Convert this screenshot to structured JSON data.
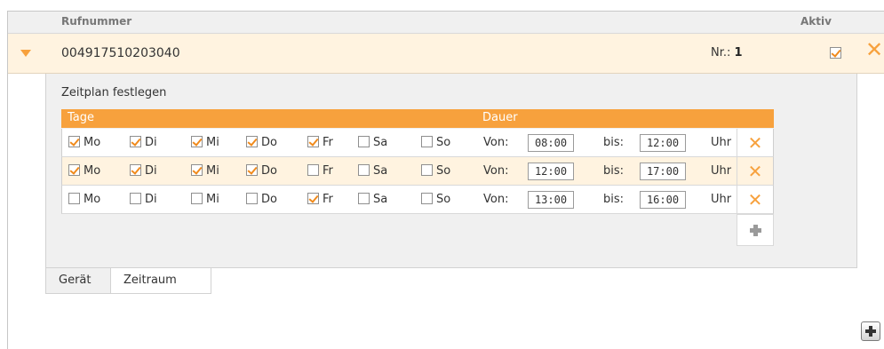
{
  "header": {
    "rufnummer_label": "Rufnummer",
    "aktiv_label": "Aktiv"
  },
  "entry": {
    "number": "004917510203040",
    "nr_label": "Nr.:",
    "nr_value": "1",
    "aktiv": true,
    "expand_icon": "triangle-down-icon",
    "delete_icon": "close-icon"
  },
  "schedule": {
    "title": "Zeitplan festlegen",
    "col_days": "Tage",
    "col_duration": "Dauer",
    "from_label": "Von:",
    "to_label": "bis:",
    "unit_label": "Uhr",
    "rows": [
      {
        "days": [
          {
            "label": "Mo",
            "checked": true
          },
          {
            "label": "Di",
            "checked": true
          },
          {
            "label": "Mi",
            "checked": true
          },
          {
            "label": "Do",
            "checked": true
          },
          {
            "label": "Fr",
            "checked": true
          },
          {
            "label": "Sa",
            "checked": false
          },
          {
            "label": "So",
            "checked": false
          }
        ],
        "from": "08:00",
        "to": "12:00"
      },
      {
        "days": [
          {
            "label": "Mo",
            "checked": true
          },
          {
            "label": "Di",
            "checked": true
          },
          {
            "label": "Mi",
            "checked": true
          },
          {
            "label": "Do",
            "checked": true
          },
          {
            "label": "Fr",
            "checked": false
          },
          {
            "label": "Sa",
            "checked": false
          },
          {
            "label": "So",
            "checked": false
          }
        ],
        "from": "12:00",
        "to": "17:00"
      },
      {
        "days": [
          {
            "label": "Mo",
            "checked": false
          },
          {
            "label": "Di",
            "checked": false
          },
          {
            "label": "Mi",
            "checked": false
          },
          {
            "label": "Do",
            "checked": false
          },
          {
            "label": "Fr",
            "checked": true
          },
          {
            "label": "Sa",
            "checked": false
          },
          {
            "label": "So",
            "checked": false
          }
        ],
        "from": "13:00",
        "to": "16:00"
      }
    ],
    "add_row_icon": "plus-icon"
  },
  "tabs": [
    {
      "label": "Gerät",
      "active": false
    },
    {
      "label": "Zeitraum",
      "active": true
    }
  ],
  "add_number_icon": "plus-icon",
  "colors": {
    "accent": "#f7a13d",
    "row_highlight": "#fff3e0",
    "panel": "#f0f0f0"
  }
}
